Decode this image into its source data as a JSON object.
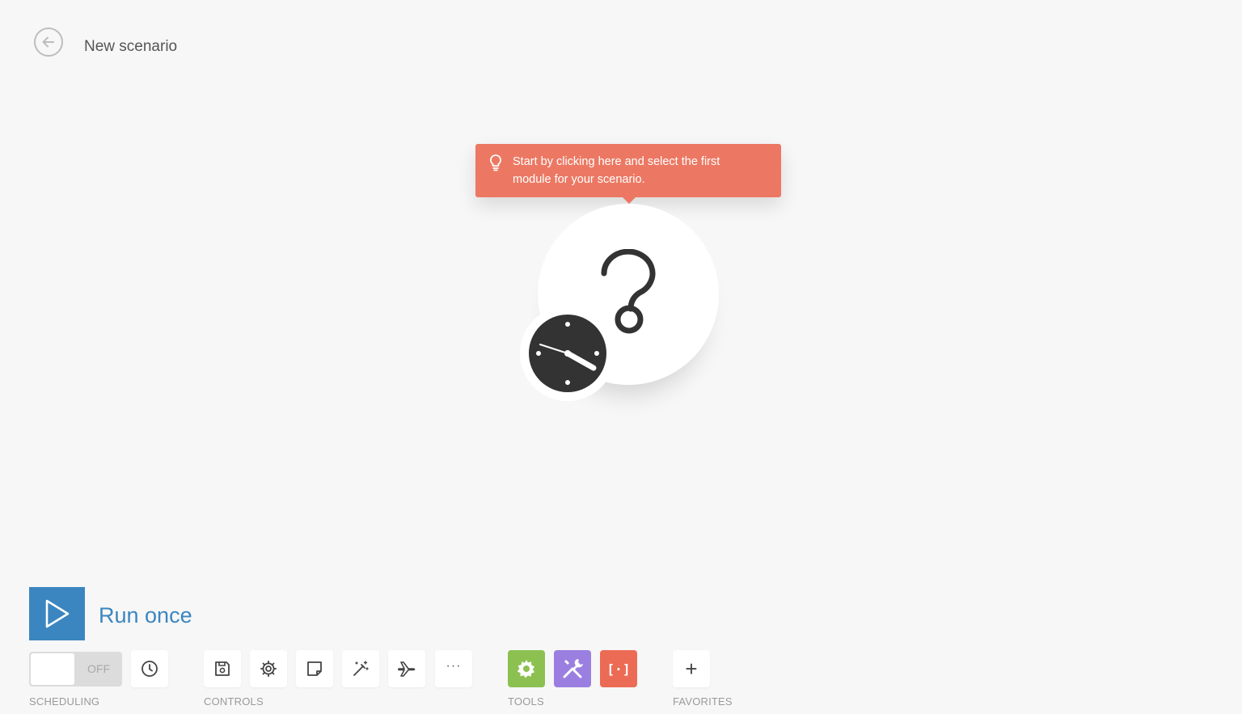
{
  "header": {
    "title": "New scenario"
  },
  "tooltip": {
    "line1": "Start by clicking here and select the first",
    "line2": "module for your scenario."
  },
  "run": {
    "label": "Run once"
  },
  "scheduling": {
    "toggle_state": "OFF",
    "group_label": "SCHEDULING"
  },
  "controls": {
    "group_label": "CONTROLS"
  },
  "tools": {
    "group_label": "TOOLS"
  },
  "favorites": {
    "group_label": "FAVORITES",
    "add_glyph": "+"
  },
  "icons": {
    "back": "arrow-left-icon",
    "bulb": "lightbulb-icon",
    "module": "question-mark-icon",
    "trigger": "clock-icon",
    "run": "play-icon",
    "schedule": "clock-icon",
    "save": "save-icon",
    "settings": "gear-icon",
    "notes": "note-icon",
    "autoalign": "magic-wand-icon",
    "flow": "airplane-icon",
    "more": "more-icon",
    "flow_control": "gear-icon",
    "tools": "tools-icon",
    "text_parser": "brackets-icon"
  },
  "colors": {
    "accent": "#3b86c0",
    "tooltip": "#ec7863",
    "flow_control": "#8cc152",
    "tools": "#9b7fe0",
    "text_parser": "#ec6b55"
  }
}
